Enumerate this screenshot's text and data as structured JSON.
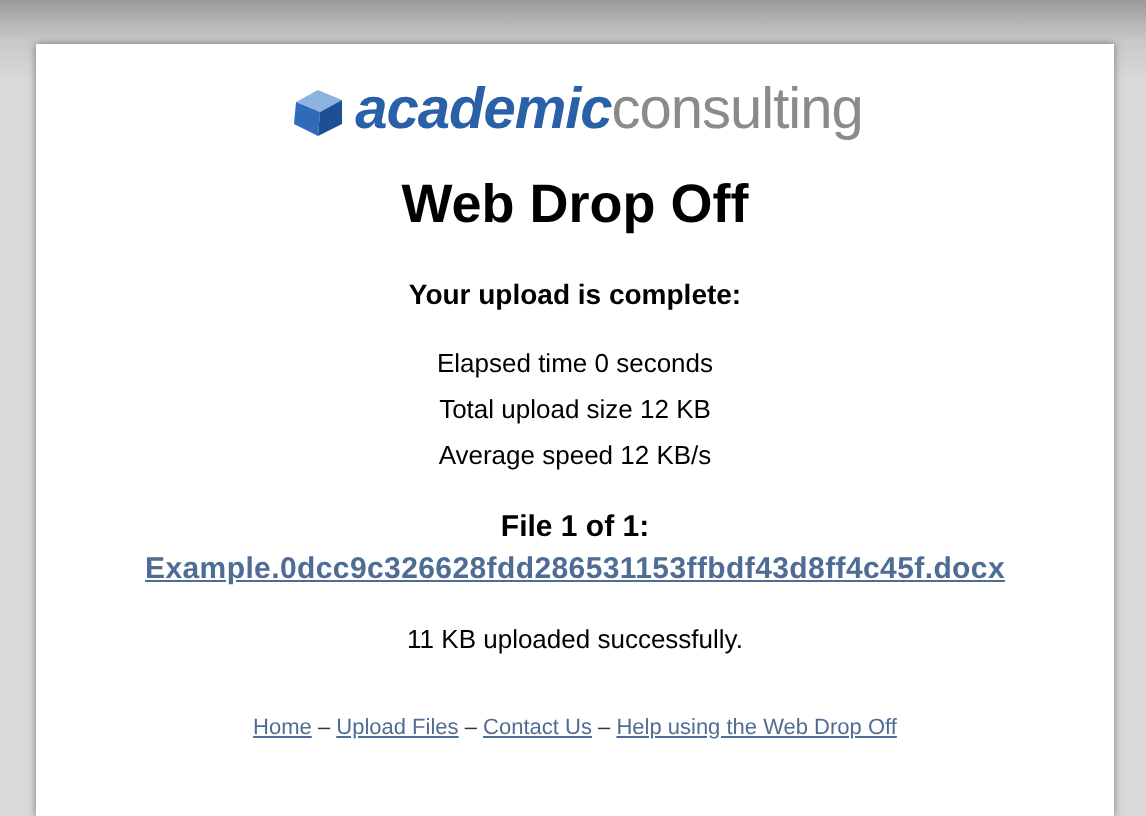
{
  "logo": {
    "bold": "academic",
    "light": "consulting"
  },
  "title": "Web Drop Off",
  "heading": "Your upload is complete:",
  "stats": [
    "Elapsed time 0 seconds",
    "Total upload size 12 KB",
    "Average speed 12 KB/s"
  ],
  "file_heading": "File 1 of 1:",
  "file_link": "Example.0dcc9c326628fdd286531153ffbdf43d8ff4c45f.docx",
  "file_status": "11 KB uploaded successfully.",
  "footer": {
    "separator": "–",
    "links": [
      "Home",
      "Upload Files",
      "Contact Us",
      "Help using the Web Drop Off"
    ]
  }
}
